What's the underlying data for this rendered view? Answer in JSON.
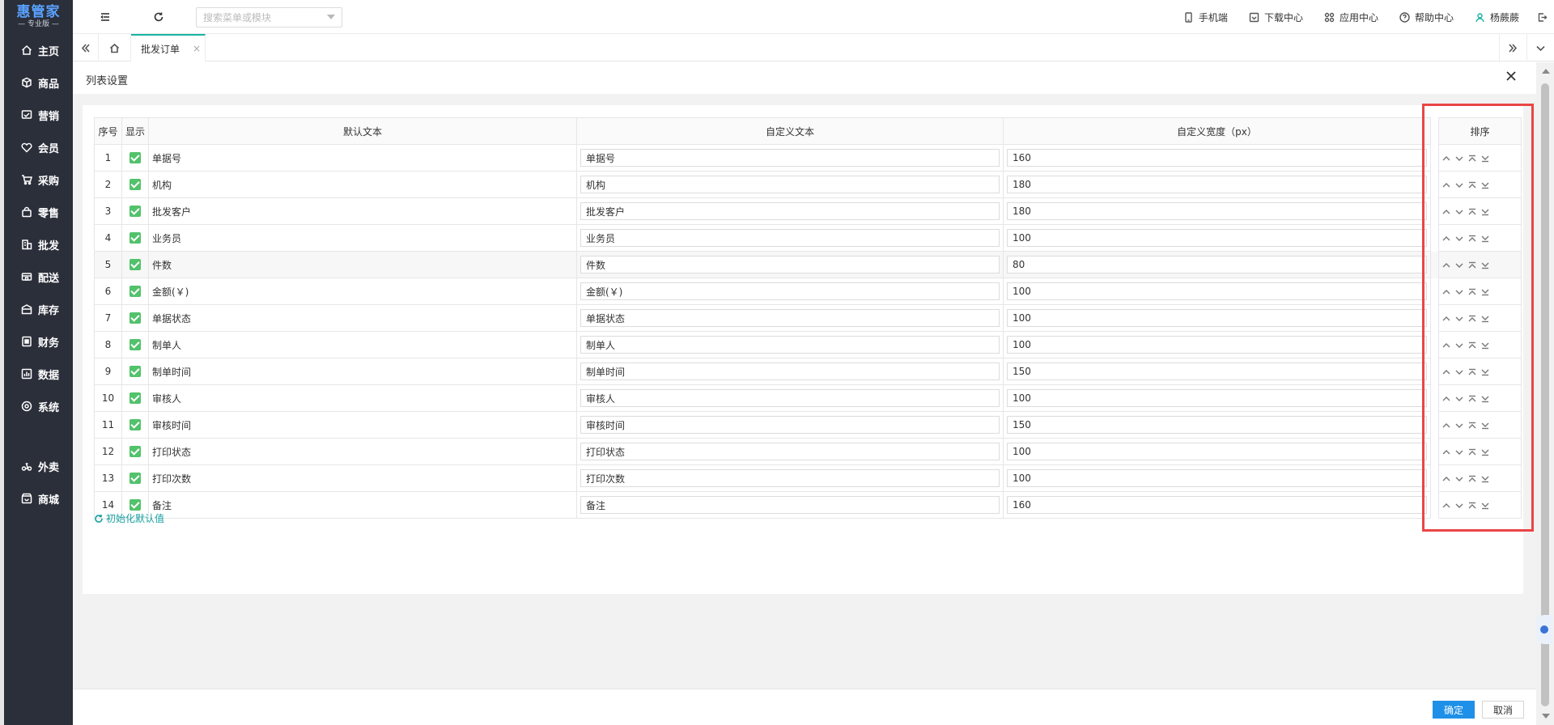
{
  "sidebar": {
    "logo_main": "惠管家",
    "logo_sub": "— 专业版 —",
    "items": [
      {
        "label": "主页",
        "icon": "home-icon"
      },
      {
        "label": "商品",
        "icon": "box-icon"
      },
      {
        "label": "营销",
        "icon": "marketing-icon"
      },
      {
        "label": "会员",
        "icon": "member-icon"
      },
      {
        "label": "采购",
        "icon": "cart-icon"
      },
      {
        "label": "零售",
        "icon": "bag-icon"
      },
      {
        "label": "批发",
        "icon": "building-icon"
      },
      {
        "label": "配送",
        "icon": "delivery-icon"
      },
      {
        "label": "库存",
        "icon": "warehouse-icon"
      },
      {
        "label": "财务",
        "icon": "finance-icon"
      },
      {
        "label": "数据",
        "icon": "chart-icon"
      },
      {
        "label": "系统",
        "icon": "settings-icon"
      }
    ],
    "extra_items": [
      {
        "label": "外卖",
        "icon": "takeout-icon"
      },
      {
        "label": "商城",
        "icon": "mall-icon"
      }
    ]
  },
  "topbar": {
    "search_placeholder": "搜索菜单或模块",
    "links": [
      "手机端",
      "下载中心",
      "应用中心",
      "帮助中心"
    ],
    "user": "杨蕨蕨"
  },
  "tabs": {
    "active": "批发订单",
    "close": "×"
  },
  "panel": {
    "title": "列表设置",
    "reset_label": "初始化默认值",
    "ok_label": "确定",
    "cancel_label": "取消"
  },
  "table": {
    "headers": [
      "序号",
      "显示",
      "默认文本",
      "自定义文本",
      "自定义宽度（px）",
      "排序"
    ],
    "rows": [
      {
        "no": "1",
        "default": "单据号",
        "custom": "单据号",
        "width": "160"
      },
      {
        "no": "2",
        "default": "机构",
        "custom": "机构",
        "width": "180"
      },
      {
        "no": "3",
        "default": "批发客户",
        "custom": "批发客户",
        "width": "180"
      },
      {
        "no": "4",
        "default": "业务员",
        "custom": "业务员",
        "width": "100"
      },
      {
        "no": "5",
        "default": "件数",
        "custom": "件数",
        "width": "80"
      },
      {
        "no": "6",
        "default": "金额(￥)",
        "custom": "金额(￥)",
        "width": "100"
      },
      {
        "no": "7",
        "default": "单据状态",
        "custom": "单据状态",
        "width": "100"
      },
      {
        "no": "8",
        "default": "制单人",
        "custom": "制单人",
        "width": "100"
      },
      {
        "no": "9",
        "default": "制单时间",
        "custom": "制单时间",
        "width": "150"
      },
      {
        "no": "10",
        "default": "审核人",
        "custom": "审核人",
        "width": "100"
      },
      {
        "no": "11",
        "default": "审核时间",
        "custom": "审核时间",
        "width": "150"
      },
      {
        "no": "12",
        "default": "打印状态",
        "custom": "打印状态",
        "width": "100"
      },
      {
        "no": "13",
        "default": "打印次数",
        "custom": "打印次数",
        "width": "100"
      },
      {
        "no": "14",
        "default": "备注",
        "custom": "备注",
        "width": "160"
      }
    ]
  },
  "colors": {
    "accent": "#17b3a3",
    "primary_button": "#1e90e8",
    "checkbox": "#52c26b",
    "highlight": "#ea4545",
    "sidebar_bg": "#2b2f3a"
  }
}
